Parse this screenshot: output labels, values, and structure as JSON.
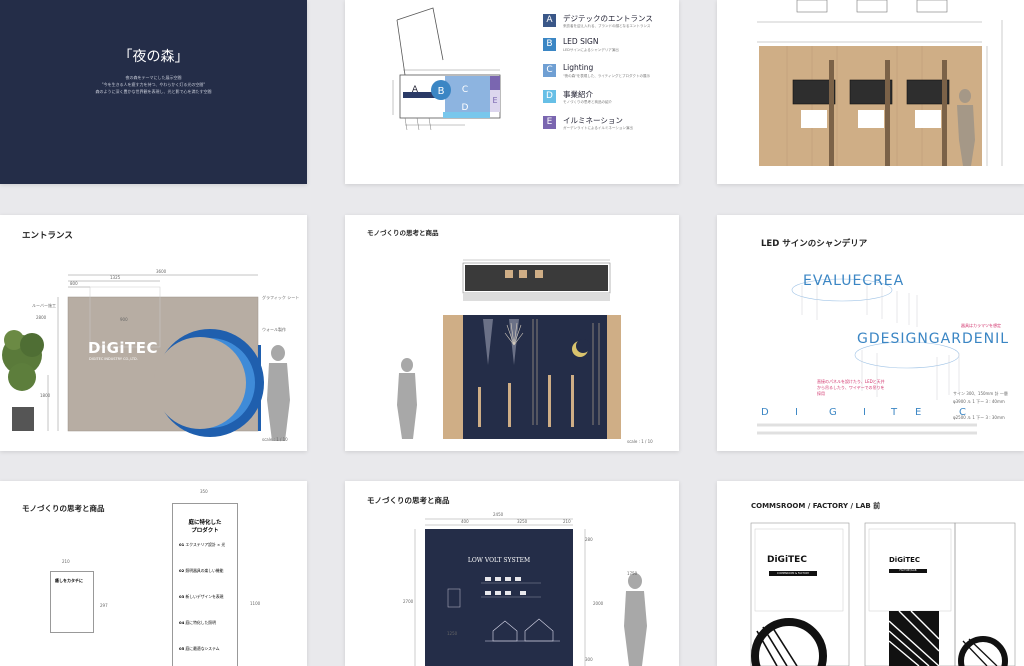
{
  "cover": {
    "title": "「夜の森」",
    "lines": [
      "夜の森をテーマにした展示空間",
      "\"今を生きる人を癒す力を持つ、やわらかく灯る光の空間\"",
      "森のように深く豊かな世界観を表現し、光と影で心を満たす空間"
    ]
  },
  "plan": {
    "zones": [
      {
        "letter": "A",
        "label": "デジテックのエントランス",
        "sub": "来訪者を迎え入れる、ブランドの顔となるエントランス",
        "color": "#3a5788"
      },
      {
        "letter": "B",
        "label": "LED SIGN",
        "sub": "LEDサインによるシャンデリア演出",
        "color": "#3b86c4"
      },
      {
        "letter": "C",
        "label": "Lighting",
        "sub": "\"夜の森\"を表現した、ライティングとプロダクトの展示",
        "color": "#6f9fd3"
      },
      {
        "letter": "D",
        "label": "事業紹介",
        "sub": "モノづくりの思考と商品の紹介",
        "color": "#67bfe6"
      },
      {
        "letter": "E",
        "label": "イルミネーション",
        "sub": "ガーデンライトによるイルミネーション演出",
        "color": "#7a66b0"
      }
    ]
  },
  "entrance": {
    "title": "エントランス",
    "logo": "DiGiTEC",
    "logo_sub": "DIGITEC INDUSTRY CO.,LTD.",
    "dims": {
      "total": "3600",
      "mid": "1325",
      "left": "800",
      "height": "2800",
      "lower": "1800",
      "door": "900"
    },
    "notes": [
      "グラフィック シート",
      "ルーバー施工",
      "ウォール製作"
    ],
    "scale": "scale : 1 / 10"
  },
  "monozukuri1": {
    "title": "モノづくりの思考と商品",
    "scale": "scale : 1 / 10"
  },
  "chandelier": {
    "title": "LED サインのシャンデリア",
    "ring1_text": "EVALUECREA",
    "ring2_text": "GDESIGNGARDENIL",
    "letters": [
      "D",
      "I",
      "G",
      "I",
      "T",
      "E",
      "C"
    ],
    "notes": [
      "器具はカラマツを想定",
      "直接のパネルを設けたり、LEDと天井から吊るしたり、ワイヤーでの吊りを採用"
    ],
    "specs": [
      "サイン 300、150mm 計 一層",
      "φ3900 ル 1 下ー 3 : 40mm",
      "φ2500 ル 1 下ー 3 : 30mm"
    ]
  },
  "product_board": {
    "title": "モノづくりの思考と商品",
    "board_title": [
      "庭に特化した",
      "プロダクト"
    ],
    "items": [
      {
        "num": "01",
        "label": "エクステリア設計 × 光"
      },
      {
        "num": "02",
        "label": "照明器具の楽しい機能"
      },
      {
        "num": "03",
        "label": "新しいデザインを表現"
      },
      {
        "num": "04",
        "label": "庭に特化した照明"
      },
      {
        "num": "05",
        "label": "庭に最適なシステム"
      }
    ],
    "small_title": "癒しをカタチに",
    "dims": {
      "board_w": "350",
      "board_h": "1100",
      "small_w": "210",
      "small_h": "297"
    }
  },
  "low_volt": {
    "title": "モノづくりの思考と商品",
    "panel_heading": "LOW VOLT SYSTEM",
    "dims": {
      "width": "2450",
      "a": "400",
      "b": "3250",
      "c": "210",
      "height": "2700",
      "h2": "2000",
      "h3": "1250",
      "person": "1750",
      "top": "280",
      "bottom": "300"
    }
  },
  "commsroom": {
    "title": "COMMSROOM / FACTORY / LAB 前",
    "logo": "DiGiTEC",
    "labels": [
      "COMMSROOM & FACTORY",
      "FACTORY/LAB"
    ]
  }
}
